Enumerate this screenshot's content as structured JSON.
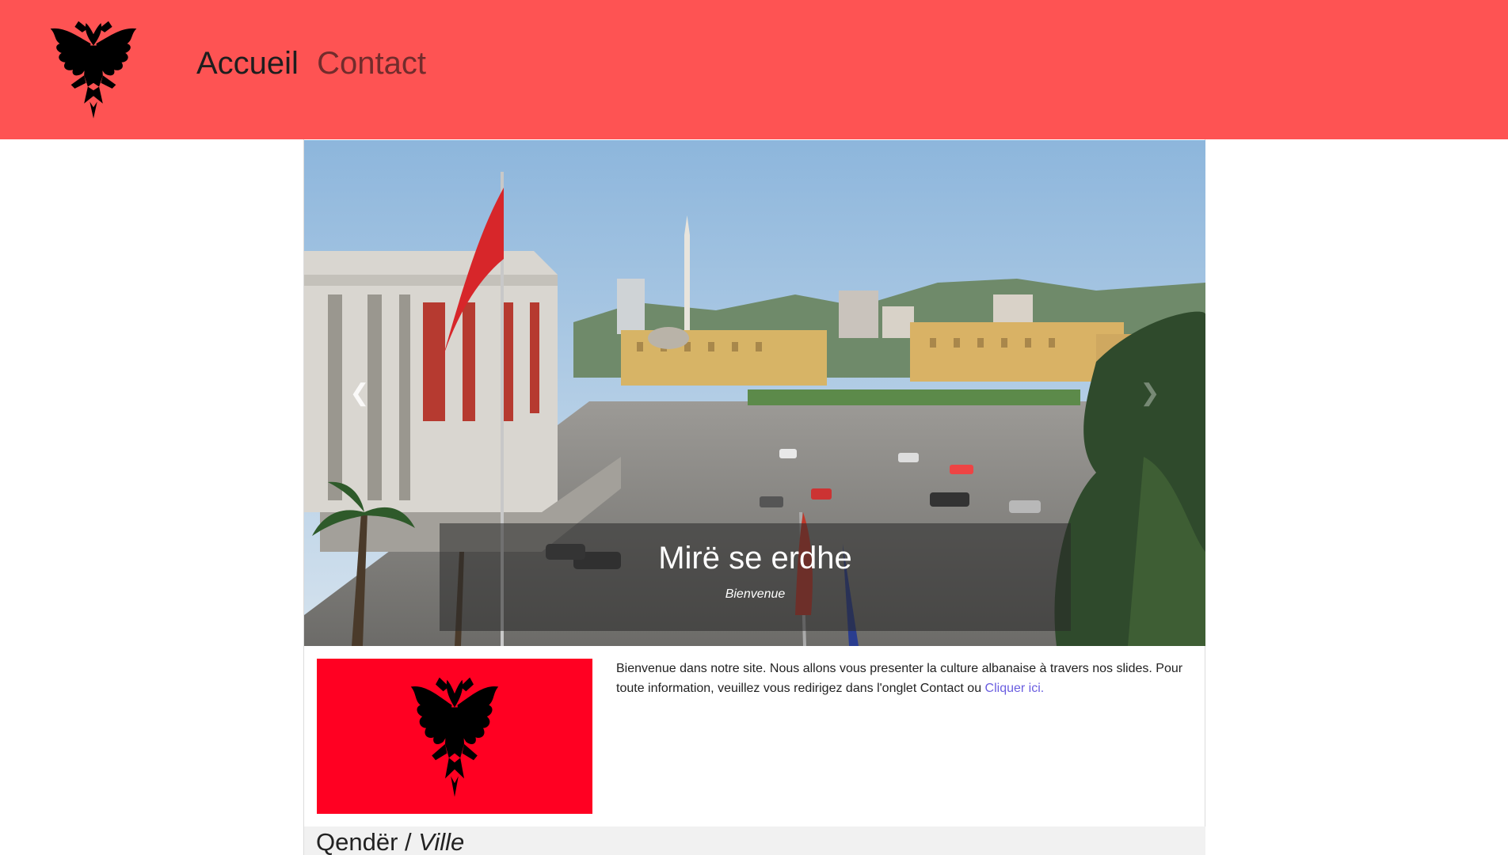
{
  "header": {
    "logo_icon": "albanian-eagle-icon",
    "nav": [
      {
        "label": "Accueil"
      },
      {
        "label": "Contact"
      }
    ]
  },
  "carousel": {
    "prev_icon": "chevron-left-icon",
    "next_icon": "chevron-right-icon",
    "caption_title": "Mirë se erdhe",
    "caption_subtitle": "Bienvenue"
  },
  "intro": {
    "flag_icon": "albanian-flag-icon",
    "text": "Bienvenue dans notre site. Nous allons vous presenter la culture albanaise à travers nos slides. Pour toute information, veuillez vous redirigez dans l'onglet Contact ou ",
    "link": "Cliquer ici."
  },
  "section": {
    "title_albanian": "Qendër /",
    "title_french": "Ville"
  },
  "colors": {
    "header_bg": "#fe5353",
    "flag_red": "#ff0022",
    "link": "#6a5ee0"
  }
}
